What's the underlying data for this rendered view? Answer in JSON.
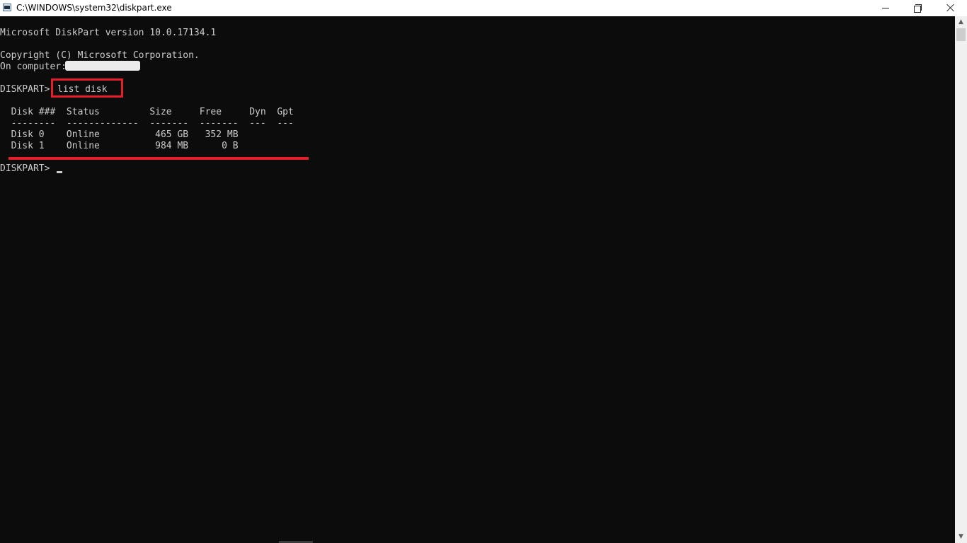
{
  "window": {
    "title": "C:\\WINDOWS\\system32\\diskpart.exe",
    "controls": {
      "minimize": "minimize-icon",
      "maximize": "restore-icon",
      "close": "close-icon"
    }
  },
  "console": {
    "version_line": "Microsoft DiskPart version 10.0.17134.1",
    "copyright_line": "Copyright (C) Microsoft Corporation.",
    "computer_line": "On computer: ",
    "prompt": "DISKPART> ",
    "command": "list disk",
    "table": {
      "header": "  Disk ###  Status         Size     Free     Dyn  Gpt",
      "separator": "  --------  -------------  -------  -------  ---  ---",
      "rows": [
        "  Disk 0    Online          465 GB   352 MB",
        "  Disk 1    Online          984 MB      0 B"
      ]
    },
    "final_prompt": "DISKPART> "
  },
  "colors": {
    "background": "#0c0c0c",
    "text": "#cccccc",
    "highlight": "#e3202a",
    "titlebar": "#ffffff"
  }
}
